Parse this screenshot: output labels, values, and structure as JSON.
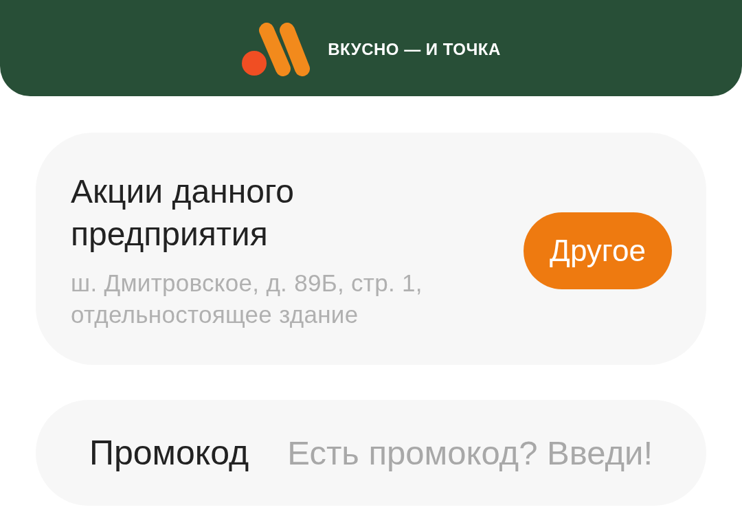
{
  "header": {
    "logo_text": "ВКУСНО — И ТОЧКА"
  },
  "store_card": {
    "title": "Акции данного предприятия",
    "address": "ш. Дмитровское, д. 89Б, стр. 1, отдельностоящее здание",
    "button": "Другое"
  },
  "promo": {
    "label": "Промокод",
    "placeholder": "Есть промокод? Введи!"
  }
}
